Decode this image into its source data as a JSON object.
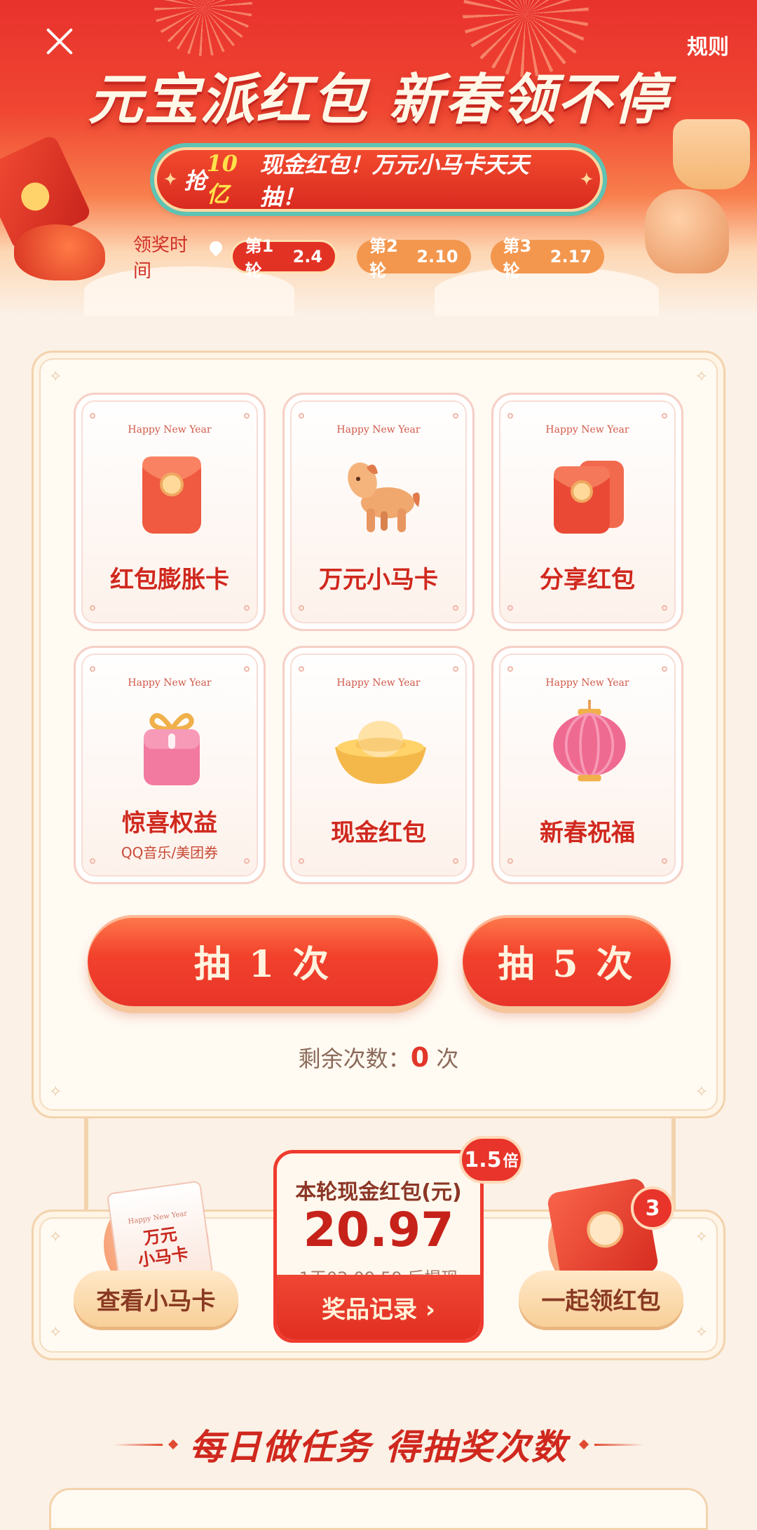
{
  "header": {
    "close_label": "×",
    "rules_label": "规则",
    "title": "元宝派红包 新春领不停",
    "banner": {
      "prefix": "抢",
      "highlight": "10亿",
      "suffix": "现金红包！万元小马卡天天抽！"
    },
    "schedule_label": "领奖时间",
    "rounds": [
      {
        "label": "第1轮",
        "date": "2.4",
        "active": true
      },
      {
        "label": "第2轮",
        "date": "2.10",
        "active": false
      },
      {
        "label": "第3轮",
        "date": "2.17",
        "active": false
      }
    ]
  },
  "prizes": [
    {
      "tag": "Happy New Year",
      "name": "红包膨胀卡",
      "sub": "",
      "icon": "red-envelope-icon"
    },
    {
      "tag": "Happy New Year",
      "name": "万元小马卡",
      "sub": "",
      "icon": "horse-icon"
    },
    {
      "tag": "Happy New Year",
      "name": "分享红包",
      "sub": "",
      "icon": "share-envelope-icon"
    },
    {
      "tag": "Happy New Year",
      "name": "惊喜权益",
      "sub": "QQ音乐/美团券",
      "icon": "gift-box-icon"
    },
    {
      "tag": "Happy New Year",
      "name": "现金红包",
      "sub": "",
      "icon": "gold-ingot-icon"
    },
    {
      "tag": "Happy New Year",
      "name": "新春祝福",
      "sub": "",
      "icon": "lantern-icon"
    }
  ],
  "draw": {
    "draw_once": "抽 1 次",
    "draw_five": "抽 5 次",
    "remaining_prefix": "剩余次数：",
    "remaining_count": "0",
    "remaining_suffix": " 次"
  },
  "wallet": {
    "view_card_label": "查看小马卡",
    "card_deco_tag": "Happy New Year",
    "card_deco_text_1": "万元",
    "card_deco_text_2": "小马卡",
    "cash_label": "本轮现金红包(元)",
    "cash_amount": "20.97",
    "timer": "1天02:09:59 后提现",
    "records_label": "奖品记录 ›",
    "multiplier": "1.5",
    "multiplier_unit": "倍",
    "together_label": "一起领红包",
    "together_count": "3"
  },
  "tasks": {
    "heading": "每日做任务  得抽奖次数"
  },
  "colors": {
    "primary_red": "#e8342a",
    "gold": "#ffd9b8",
    "background": "#fbf1e6"
  }
}
